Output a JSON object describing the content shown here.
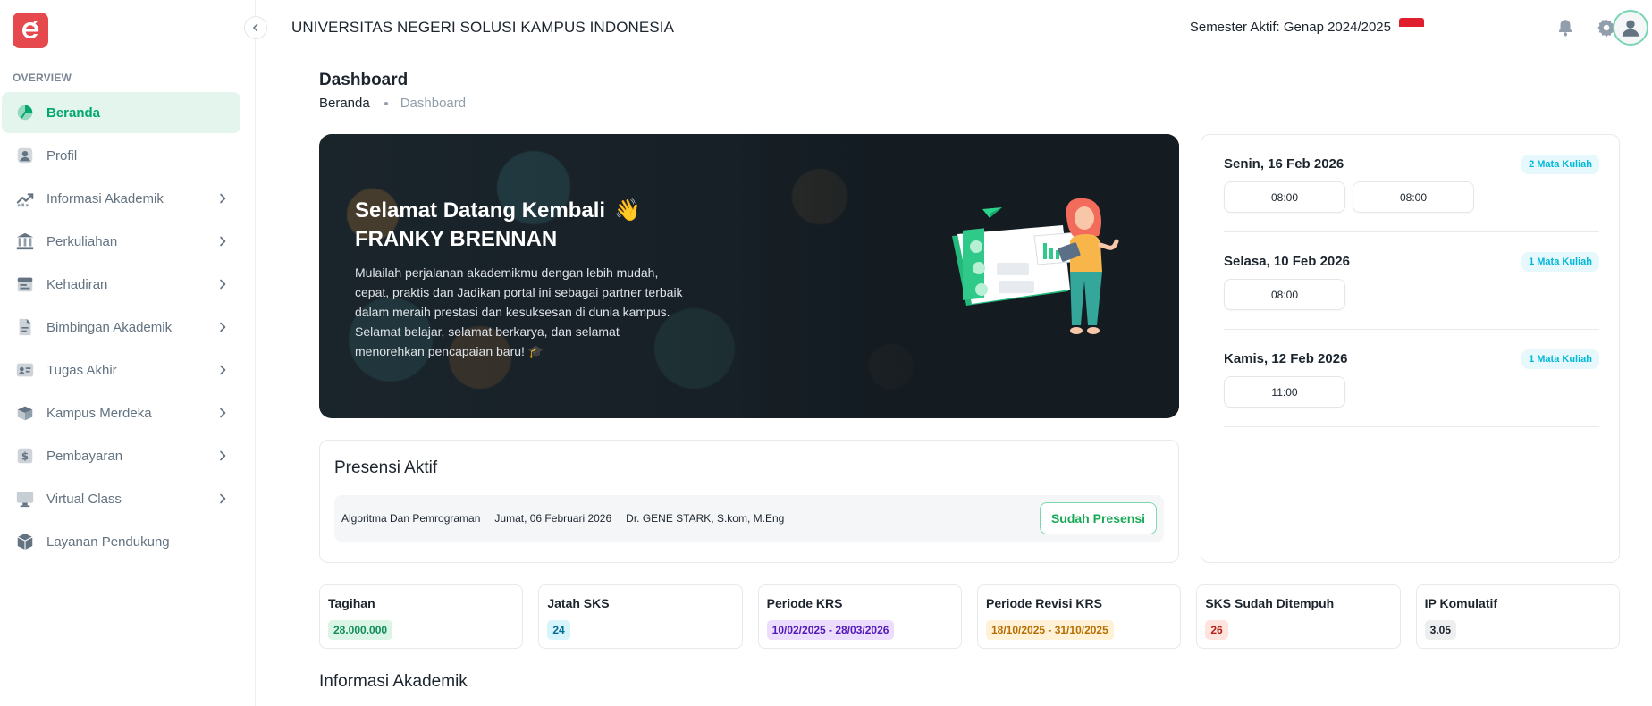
{
  "sidebar": {
    "section_label": "OVERVIEW",
    "items": [
      {
        "label": "Beranda",
        "icon": "dashboard-icon",
        "active": true,
        "has_children": false
      },
      {
        "label": "Profil",
        "icon": "user-icon",
        "active": false,
        "has_children": false
      },
      {
        "label": "Informasi Akademik",
        "icon": "chart-icon",
        "active": false,
        "has_children": true
      },
      {
        "label": "Perkuliahan",
        "icon": "building-icon",
        "active": false,
        "has_children": true
      },
      {
        "label": "Kehadiran",
        "icon": "calendar-icon",
        "active": false,
        "has_children": true
      },
      {
        "label": "Bimbingan Akademik",
        "icon": "document-icon",
        "active": false,
        "has_children": true
      },
      {
        "label": "Tugas Akhir",
        "icon": "id-card-icon",
        "active": false,
        "has_children": true
      },
      {
        "label": "Kampus Merdeka",
        "icon": "box-icon",
        "active": false,
        "has_children": true
      },
      {
        "label": "Pembayaran",
        "icon": "dollar-icon",
        "active": false,
        "has_children": true
      },
      {
        "label": "Virtual Class",
        "icon": "monitor-icon",
        "active": false,
        "has_children": true
      },
      {
        "label": "Layanan Pendukung",
        "icon": "package-icon",
        "active": false,
        "has_children": false
      }
    ]
  },
  "header": {
    "university": "UNIVERSITAS NEGERI SOLUSI KAMPUS INDONESIA",
    "semester": "Semester Aktif: Genap 2024/2025"
  },
  "page": {
    "title": "Dashboard",
    "breadcrumb": [
      "Beranda",
      "Dashboard"
    ]
  },
  "banner": {
    "greeting": "Selamat Datang Kembali",
    "wave": "👋",
    "name": "FRANKY BRENNAN",
    "text": "Mulailah perjalanan akademikmu dengan lebih mudah, cepat, praktis dan Jadikan portal ini sebagai partner terbaik dalam meraih prestasi dan kesuksesan di dunia kampus. Selamat belajar, selamat berkarya, dan selamat menorehkan pencapaian baru! 🎓"
  },
  "schedule": [
    {
      "day": "Senin, 16 Feb 2026",
      "badge": "2 Mata Kuliah",
      "slots": [
        "08:00",
        "08:00"
      ]
    },
    {
      "day": "Selasa, 10 Feb 2026",
      "badge": "1 Mata Kuliah",
      "slots": [
        "08:00"
      ]
    },
    {
      "day": "Kamis, 12 Feb 2026",
      "badge": "1 Mata Kuliah",
      "slots": [
        "11:00"
      ]
    }
  ],
  "presensi": {
    "title": "Presensi Aktif",
    "course": "Algoritma Dan Pemrograman",
    "date": "Jumat, 06 Februari 2026",
    "lecturer": "Dr. GENE STARK, S.kom, M.Eng",
    "button": "Sudah Presensi"
  },
  "stats": [
    {
      "label": "Tagihan",
      "value": "28.000.000",
      "fg": "#118d57",
      "bg": "#daf5e6"
    },
    {
      "label": "Jatah SKS",
      "value": "24",
      "fg": "#006c9c",
      "bg": "#d6f4f9"
    },
    {
      "label": "Periode KRS",
      "value": "10/02/2025 - 28/03/2026",
      "fg": "#5119b7",
      "bg": "#ecdcfd"
    },
    {
      "label": "Periode Revisi KRS",
      "value": "18/10/2025 - 31/10/2025",
      "fg": "#b76e00",
      "bg": "#fff1d6"
    },
    {
      "label": "SKS Sudah Ditempuh",
      "value": "26",
      "fg": "#b71d18",
      "bg": "#ffe4de"
    },
    {
      "label": "IP Komulatif",
      "value": "3.05",
      "fg": "#1c252e",
      "bg": "#eceef0"
    }
  ],
  "section_info_title": "Informasi Akademik",
  "colors": {
    "brand": "#e5484d",
    "accent": "#00a76f"
  }
}
